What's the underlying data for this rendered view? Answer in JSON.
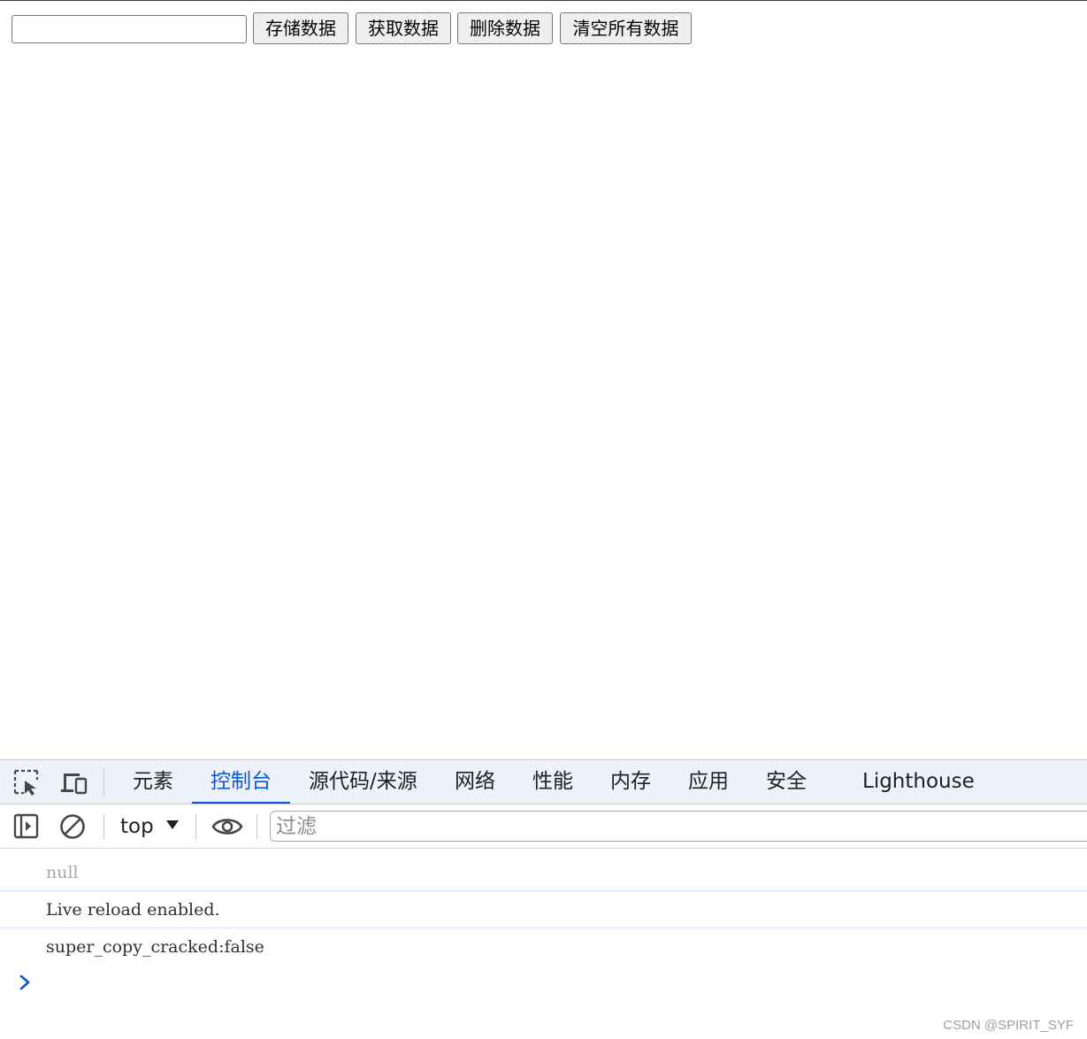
{
  "page": {
    "input": {
      "value": "",
      "placeholder": ""
    },
    "buttons": {
      "store": "存储数据",
      "get": "获取数据",
      "delete": "删除数据",
      "clear_all": "清空所有数据"
    }
  },
  "devtools": {
    "icons": {
      "inspect": "inspect-element-icon",
      "device": "device-toolbar-icon",
      "sidebar": "show-sidebar-icon",
      "clear": "clear-console-icon",
      "live_expression": "eye-icon",
      "prompt": "chevron-right-icon"
    },
    "tabs": [
      {
        "label": "元素",
        "active": false
      },
      {
        "label": "控制台",
        "active": true
      },
      {
        "label": "源代码/来源",
        "active": false
      },
      {
        "label": "网络",
        "active": false
      },
      {
        "label": "性能",
        "active": false
      },
      {
        "label": "内存",
        "active": false
      },
      {
        "label": "应用",
        "active": false
      },
      {
        "label": "安全",
        "active": false
      },
      {
        "label": "Lighthouse",
        "active": false
      }
    ],
    "toolbar": {
      "context": "top",
      "filter_placeholder": "过滤",
      "filter_value": ""
    },
    "console": {
      "messages": [
        "null",
        "Live reload enabled.",
        "super_copy_cracked:false"
      ]
    },
    "colors": {
      "accent": "#0b57d0",
      "tabbar_bg": "#edf2fa",
      "row_divider": "#d3e3fd",
      "muted_text": "#a7a7a7"
    }
  },
  "watermark": "CSDN @SPIRIT_SYF"
}
